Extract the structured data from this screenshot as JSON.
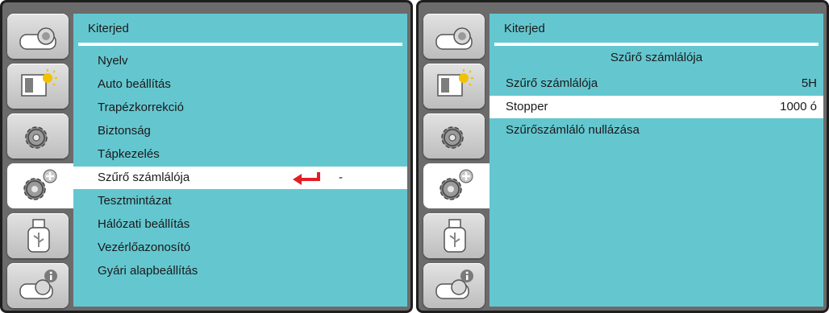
{
  "left_screen": {
    "title": "Kiterjed",
    "menu_items": [
      {
        "label": "Nyelv"
      },
      {
        "label": "Auto beállítás"
      },
      {
        "label": "Trapézkorrekció"
      },
      {
        "label": "Biztonság"
      },
      {
        "label": "Tápkezelés"
      },
      {
        "label": "Szűrő számlálója",
        "value": "-",
        "selected": true
      },
      {
        "label": "Tesztmintázat"
      },
      {
        "label": "Hálózati beállítás"
      },
      {
        "label": "Vezérlőazonosító"
      },
      {
        "label": "Gyári alapbeállítás"
      }
    ],
    "enter_icon": "enter-arrow-icon",
    "enter_icon_color": "#e31e24"
  },
  "right_screen": {
    "title": "Kiterjed",
    "subtitle": "Szűrő számlálója",
    "items": [
      {
        "label": "Szűrő számlálója",
        "value": "5H"
      },
      {
        "label": "Stopper",
        "value": "1000 ó",
        "selected": true
      },
      {
        "label": "Szűrőszámláló nullázása",
        "value": ""
      }
    ]
  },
  "sidebar_tabs": [
    {
      "icon": "projector-icon"
    },
    {
      "icon": "picture-brightness-icon"
    },
    {
      "icon": "gear-icon"
    },
    {
      "icon": "gear-plus-icon",
      "active": true
    },
    {
      "icon": "usb-icon"
    },
    {
      "icon": "info-projector-icon"
    }
  ],
  "colors": {
    "panel": "#64c7d0",
    "frame": "#6b6b6b",
    "selected_row": "#ffffff",
    "accent_red": "#e31e24"
  }
}
